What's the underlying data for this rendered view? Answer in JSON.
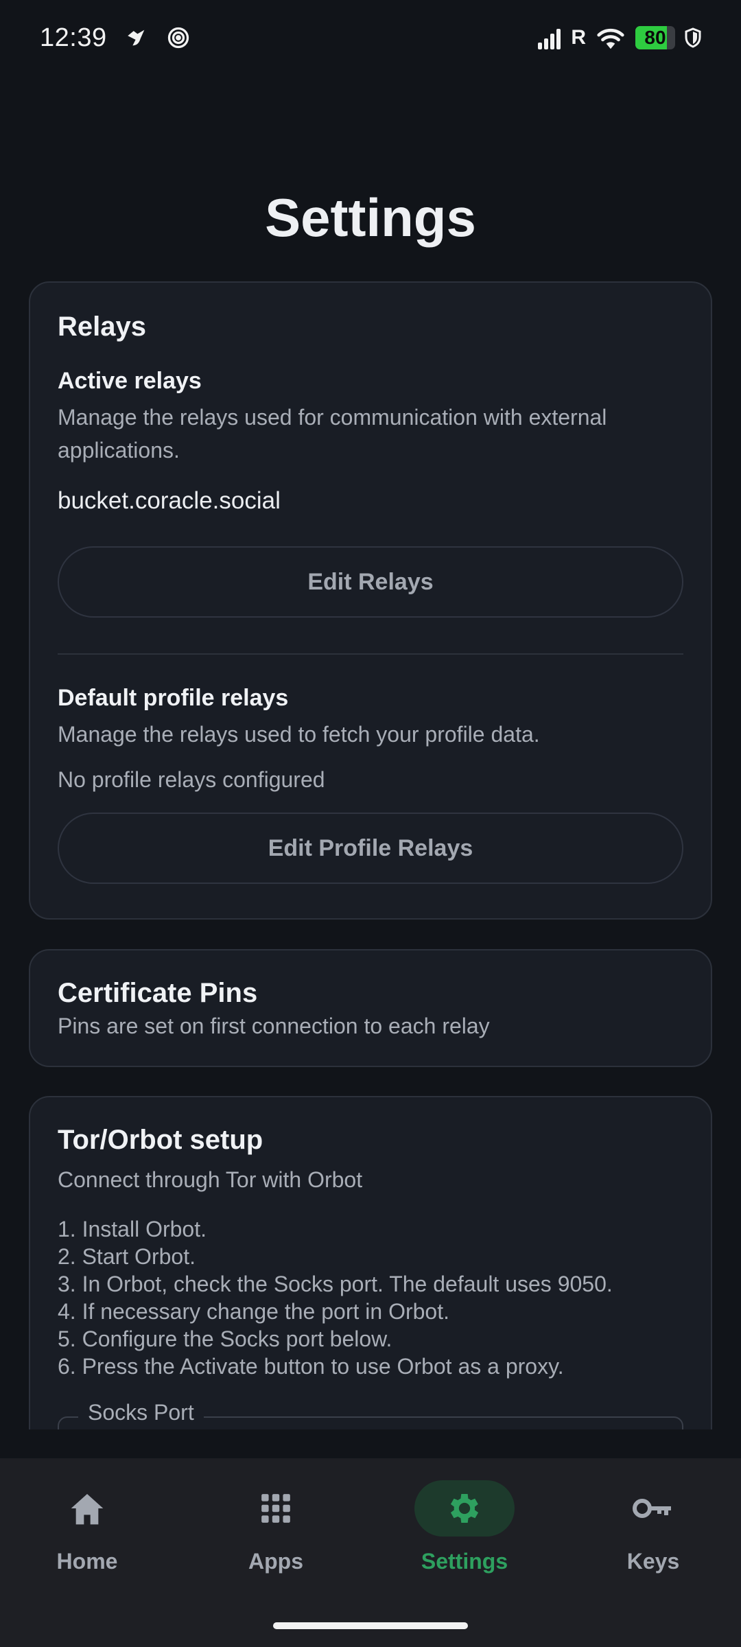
{
  "status_bar": {
    "time": "12:39",
    "network_label": "R",
    "battery_level": 80,
    "battery_text": "80",
    "icons": [
      "bird-notification-icon",
      "spiral-notification-icon",
      "signal-icon",
      "wifi-icon",
      "battery-icon",
      "shield-icon"
    ]
  },
  "page": {
    "title": "Settings"
  },
  "relays": {
    "title": "Relays",
    "active_title": "Active relays",
    "active_desc": "Manage the relays used for communication with external applications.",
    "active_value": "bucket.coracle.social",
    "edit_relays_label": "Edit Relays",
    "default_title": "Default profile relays",
    "default_desc": "Manage the relays used to fetch your profile data.",
    "default_value": "No profile relays configured",
    "edit_profile_relays_label": "Edit Profile Relays"
  },
  "pins": {
    "title": "Certificate Pins",
    "desc": "Pins are set on first connection to each relay"
  },
  "tor": {
    "title": "Tor/Orbot setup",
    "desc": "Connect through Tor with Orbot",
    "steps": [
      "1. Install Orbot.",
      "2. Start Orbot.",
      "3. In Orbot, check the Socks port. The default uses 9050.",
      "4. If necessary change the port in Orbot.",
      "5. Configure the Socks port below.",
      "6. Press the Activate button to use Orbot as a proxy."
    ],
    "socks_label": "Socks Port"
  },
  "nav": {
    "items": [
      {
        "label": "Home",
        "icon": "home-icon"
      },
      {
        "label": "Apps",
        "icon": "apps-grid-icon"
      },
      {
        "label": "Settings",
        "icon": "gear-icon"
      },
      {
        "label": "Keys",
        "icon": "key-icon"
      }
    ],
    "active": "Settings"
  },
  "colors": {
    "background": "#111419",
    "card": "#191d25",
    "accent": "#2ea05f",
    "accent_bg": "#1d3a2c",
    "battery": "#2ecc40"
  }
}
